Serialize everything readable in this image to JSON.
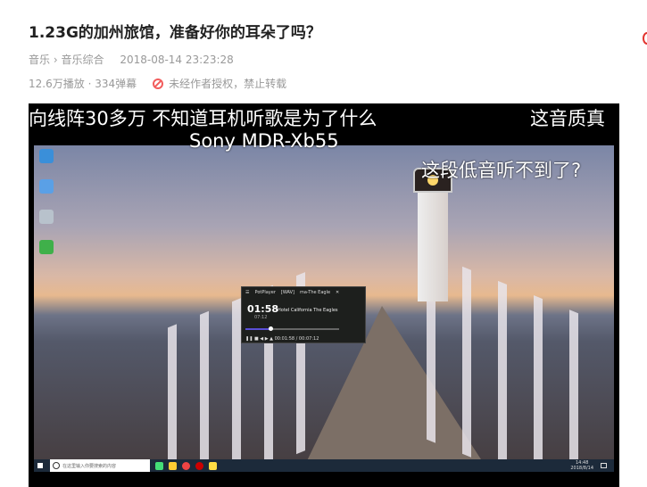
{
  "title": "1.23G的加州旅馆，准备好你的耳朵了吗？",
  "breadcrumb": {
    "category": "音乐",
    "separator": "›",
    "subcategory": "音乐综合"
  },
  "publish_time": "2018-08-14 23:23:28",
  "stats": {
    "views": "12.6万播放",
    "separator": "·",
    "danmaku": "334弹幕",
    "copyright": "未经作者授权，禁止转载"
  },
  "video": {
    "danmaku": [
      "向线阵30多万 不知道耳机听歌是为了什么",
      "这音质真",
      "Sony MDR-Xb55",
      "这段低音听不到了?"
    ],
    "taskbar": {
      "search_placeholder": "在这里输入你要搜索的内容",
      "clock_time": "14:48",
      "clock_date": "2018/8/14"
    },
    "player": {
      "app": "PotPlayer",
      "format": "[WAV]",
      "file": "ma-The Eagle",
      "elapsed": "01:58",
      "total": "07:12",
      "song": "Hotel California The Eagles",
      "progress_text": "00:01:58 / 00:07:12",
      "progress": 0.27
    }
  }
}
